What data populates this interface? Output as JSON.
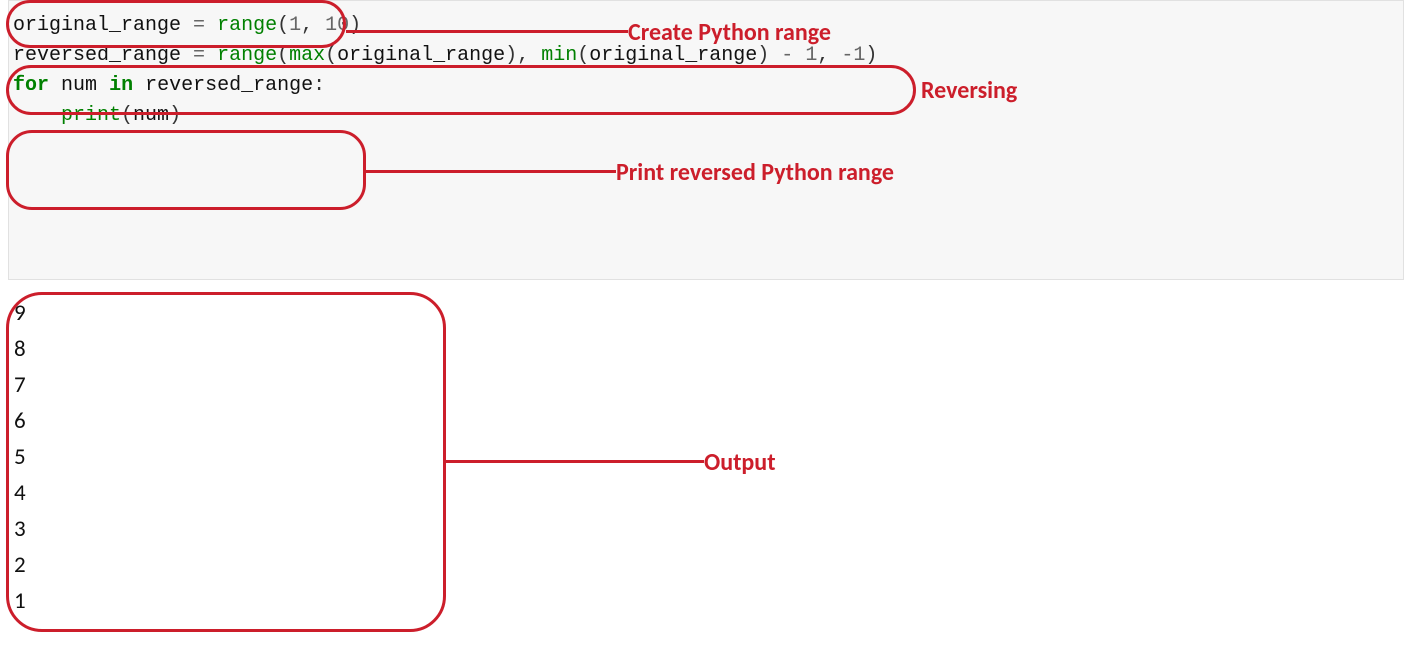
{
  "code": {
    "line1": {
      "name1": "original_range",
      "space1": " ",
      "op": "=",
      "space2": " ",
      "func": "range",
      "open": "(",
      "arg1": "1",
      "comma": ", ",
      "arg2": "10",
      "close": ")"
    },
    "blank1": "",
    "line2": {
      "name1": "reversed_range",
      "space1": " ",
      "op": "=",
      "space2": " ",
      "func": "range",
      "open": "(",
      "max": "max",
      "mopen": "(",
      "marg": "original_range",
      "mclose": ")",
      "comma1": ", ",
      "min": "min",
      "minopen": "(",
      "minarg": "original_range",
      "minclose": ")",
      "space3": " ",
      "minusop": "-",
      "space4": " ",
      "one": "1",
      "comma2": ", ",
      "negone_minus": "-",
      "negone_num": "1",
      "close": ")"
    },
    "blank2": "",
    "line3": {
      "for": "for",
      "space1": " ",
      "var": "num",
      "space2": " ",
      "in": "in",
      "space3": " ",
      "iter": "reversed_range",
      "colon": ":"
    },
    "line4": {
      "indent": "    ",
      "print": "print",
      "open": "(",
      "arg": "num",
      "close": ")"
    }
  },
  "output_lines": [
    "9",
    "8",
    "7",
    "6",
    "5",
    "4",
    "3",
    "2",
    "1"
  ],
  "labels": {
    "create": "Create Python range",
    "reverse": "Reversing",
    "print": "Print reversed Python range",
    "output": "Output"
  }
}
